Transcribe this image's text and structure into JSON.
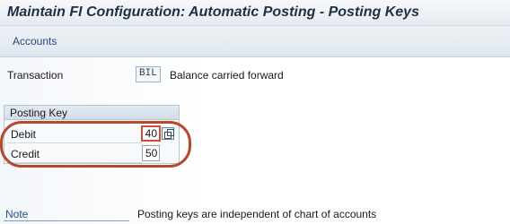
{
  "window": {
    "title": "Maintain FI Configuration: Automatic Posting - Posting Keys"
  },
  "toolbar": {
    "accounts_label": "Accounts"
  },
  "transaction": {
    "label": "Transaction",
    "code": "BIL",
    "description": "Balance carried forward"
  },
  "posting_key": {
    "group_title": "Posting Key",
    "debit_label": "Debit",
    "debit_value": "40",
    "credit_label": "Credit",
    "credit_value": "50"
  },
  "note": {
    "label": "Note",
    "text": "Posting keys are independent of chart of accounts"
  },
  "colors": {
    "highlight": "#b5492c",
    "link": "#1f4e8c"
  },
  "icons": {
    "value_help": "copy-icon"
  }
}
